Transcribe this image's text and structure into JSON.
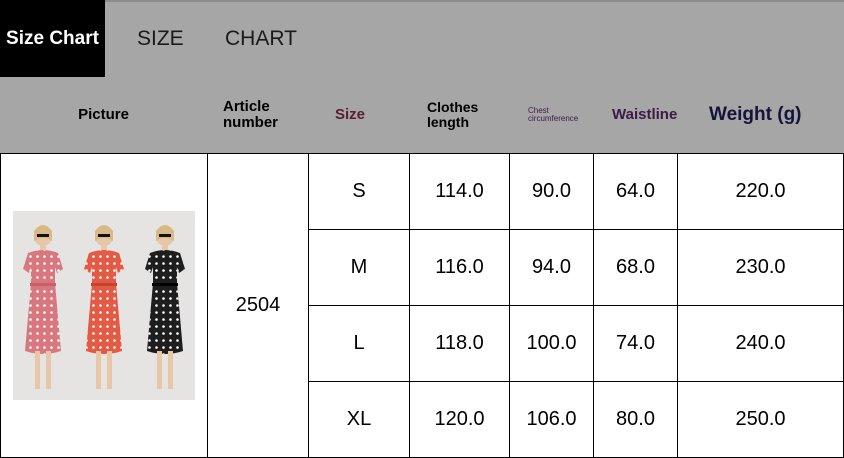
{
  "banner": {
    "tag": "Size Chart",
    "word1": "SIZE",
    "word2": "CHART"
  },
  "headers": {
    "picture": "Picture",
    "article_line1": "Article",
    "article_line2": "number",
    "size": "Size",
    "clothes_line1": "Clothes",
    "clothes_line2": "length",
    "chest_line1": "Chest",
    "chest_line2": "circumference",
    "waistline": "Waistline",
    "weight": "Weight (g)"
  },
  "article_number": "2504",
  "rows": [
    {
      "size": "S",
      "clothes_length": "114.0",
      "chest": "90.0",
      "waist": "64.0",
      "weight": "220.0"
    },
    {
      "size": "M",
      "clothes_length": "116.0",
      "chest": "94.0",
      "waist": "68.0",
      "weight": "230.0"
    },
    {
      "size": "L",
      "clothes_length": "118.0",
      "chest": "100.0",
      "waist": "74.0",
      "weight": "240.0"
    },
    {
      "size": "XL",
      "clothes_length": "120.0",
      "chest": "106.0",
      "waist": "80.0",
      "weight": "250.0"
    }
  ],
  "colors": {
    "header_band": "#a6a6a6",
    "size_header": "#5a1f2a",
    "waistline_header": "#3d1a47",
    "weight_header": "#14143c",
    "dress_pink": "#d9777f",
    "dress_orange": "#e35a45",
    "dress_black": "#1e1e1e"
  },
  "picture": {
    "description_icon": "three-dress-models-image"
  }
}
